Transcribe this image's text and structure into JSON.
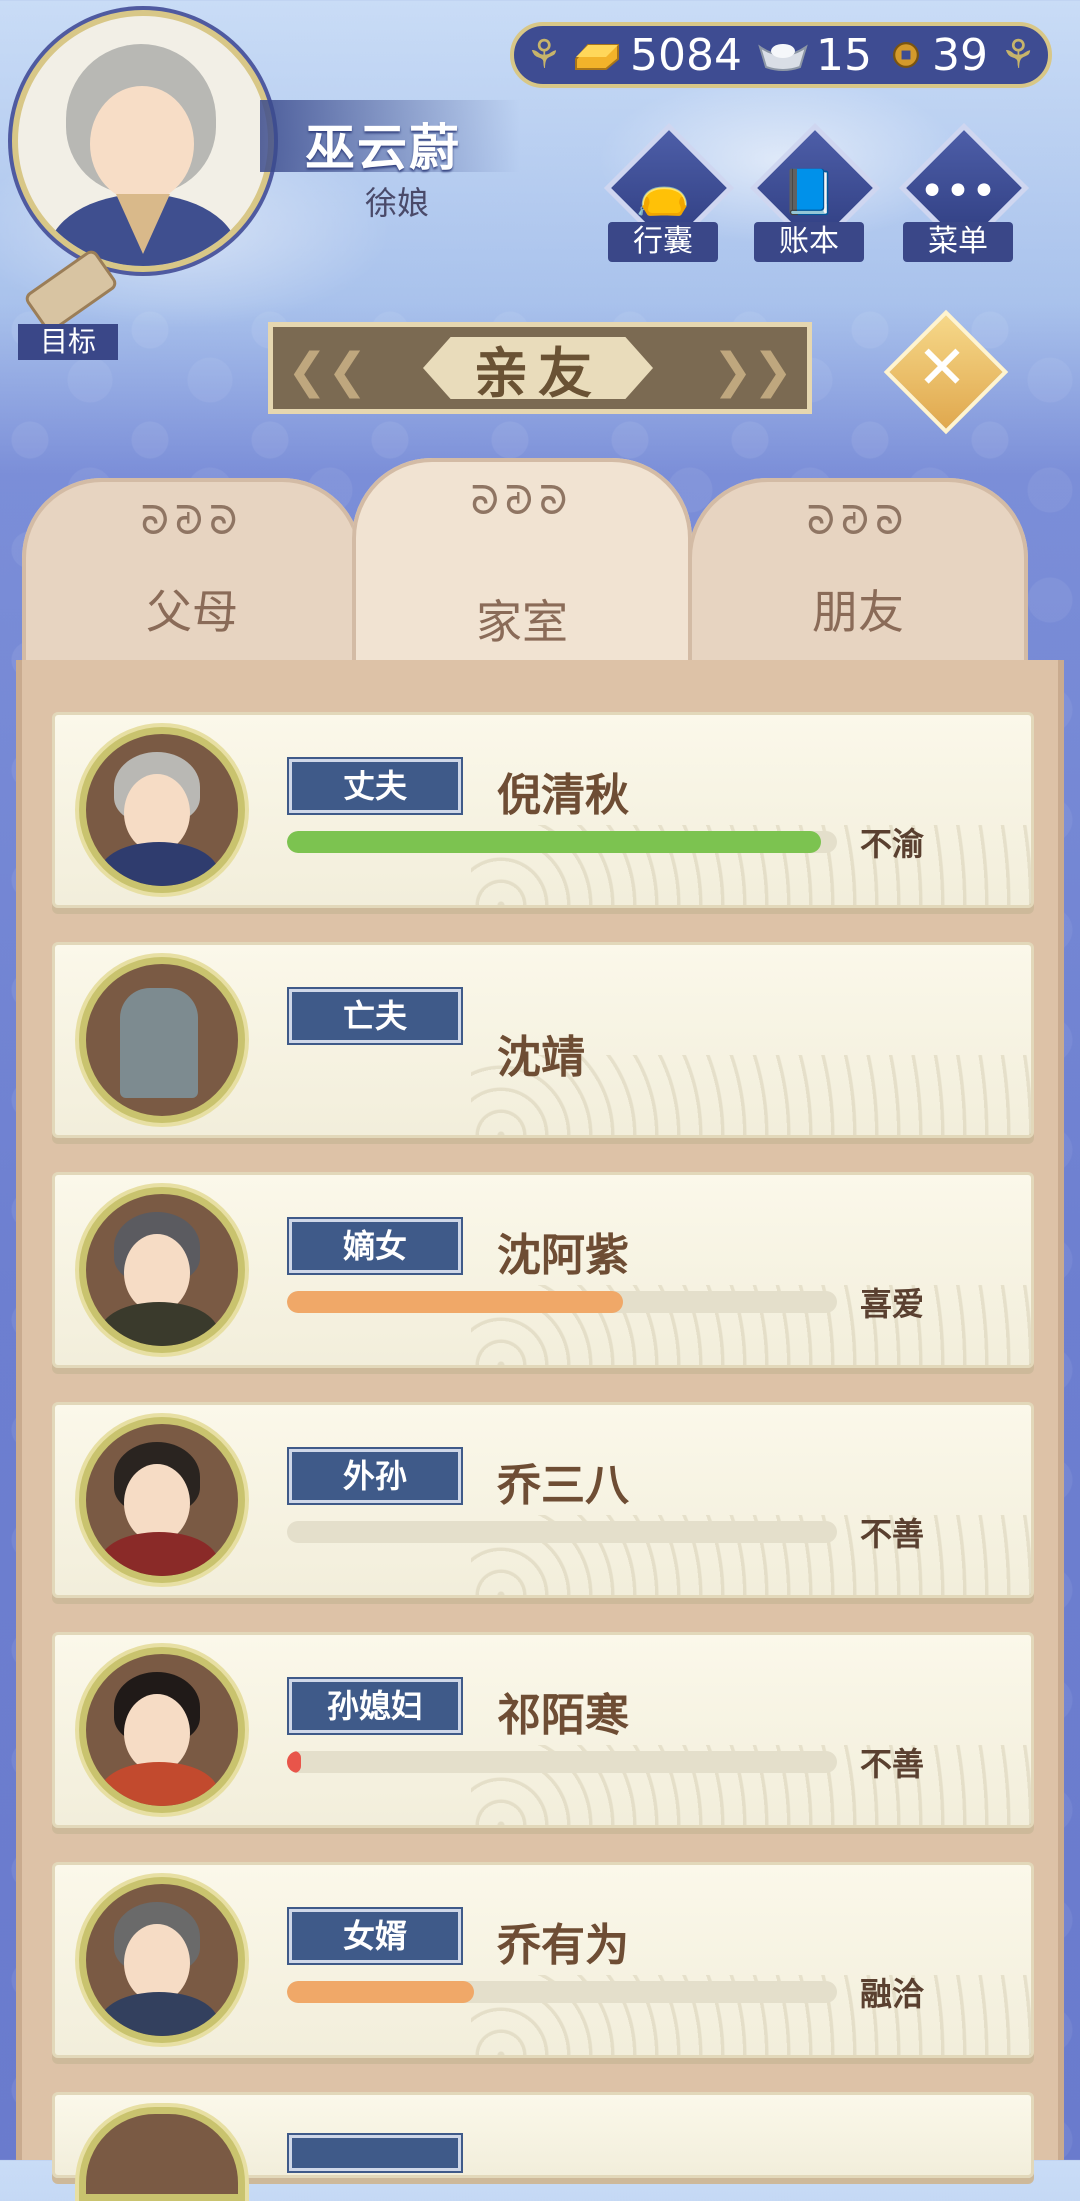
{
  "player": {
    "name": "巫云蔚",
    "title": "徐娘"
  },
  "currency": [
    {
      "icon": "gold-ingot-icon",
      "value": "5084"
    },
    {
      "icon": "silver-ingot-icon",
      "value": "15"
    },
    {
      "icon": "copper-coin-icon",
      "value": "39"
    }
  ],
  "menu": {
    "bag_label": "行囊",
    "ledger_label": "账本",
    "menu_label": "菜单",
    "target_label": "目标"
  },
  "panel": {
    "title": "亲友",
    "tabs": [
      {
        "label": "父母",
        "active": false
      },
      {
        "label": "家室",
        "active": true
      },
      {
        "label": "朋友",
        "active": false
      }
    ]
  },
  "relatives": [
    {
      "relation": "丈夫",
      "name": "倪清秋",
      "mood": "不渝",
      "affinity": 0.97,
      "bar_color": "#7cc350"
    },
    {
      "relation": "亡夫",
      "name": "沈靖",
      "mood": "",
      "affinity": null,
      "bar_color": ""
    },
    {
      "relation": "嫡女",
      "name": "沈阿紫",
      "mood": "喜爱",
      "affinity": 0.61,
      "bar_color": "#f0a868"
    },
    {
      "relation": "外孙",
      "name": "乔三八",
      "mood": "不善",
      "affinity": 0.0,
      "bar_color": "#f0a868"
    },
    {
      "relation": "孙媳妇",
      "name": "祁陌寒",
      "mood": "不善",
      "affinity": 0.02,
      "bar_color": "#e8554a"
    },
    {
      "relation": "女婿",
      "name": "乔有为",
      "mood": "融洽",
      "affinity": 0.34,
      "bar_color": "#f0a868"
    }
  ],
  "colors": {
    "accent_gold": "#d8c787",
    "label_blue": "#3f5a89",
    "text_brown": "#6e4d34"
  }
}
